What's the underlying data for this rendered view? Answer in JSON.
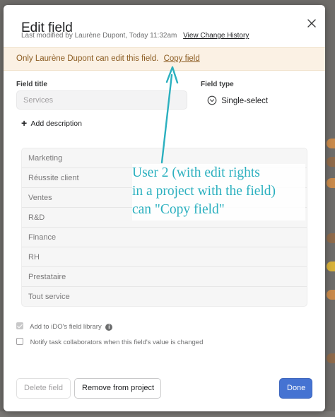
{
  "dialog": {
    "title": "Edit field",
    "modified_text": "Last modified by Laurène Dupont, Today 11:32am",
    "history_link": "View Change History"
  },
  "banner": {
    "text": "Only Laurène Dupont can edit this field.",
    "copy_link": "Copy field"
  },
  "form": {
    "field_title_label": "Field title",
    "field_title_placeholder": "Services",
    "field_type_label": "Field type",
    "field_type_value": "Single-select",
    "add_description": "Add description"
  },
  "options": [
    "Marketing",
    "Réussite client",
    "Ventes",
    "R&D",
    "Finance",
    "RH",
    "Prestataire",
    "Tout service"
  ],
  "checkboxes": {
    "library_label": "Add to iDO's field library",
    "library_checked": true,
    "notify_label": "Notify task collaborators when this field's value is changed",
    "notify_checked": false
  },
  "buttons": {
    "delete": "Delete field",
    "remove": "Remove from project",
    "done": "Done"
  },
  "annotation": {
    "line1": "User 2 (with edit rights",
    "line2": "in a project with the field)",
    "line3": "can \"Copy field\""
  },
  "colors": {
    "accent": "#4573d2",
    "banner_bg": "#fbf1e4",
    "annotation": "#2bb0bf"
  },
  "icons": {
    "close": "close-icon",
    "field_type": "single-select-icon",
    "info": "info-icon",
    "add": "plus-icon"
  }
}
